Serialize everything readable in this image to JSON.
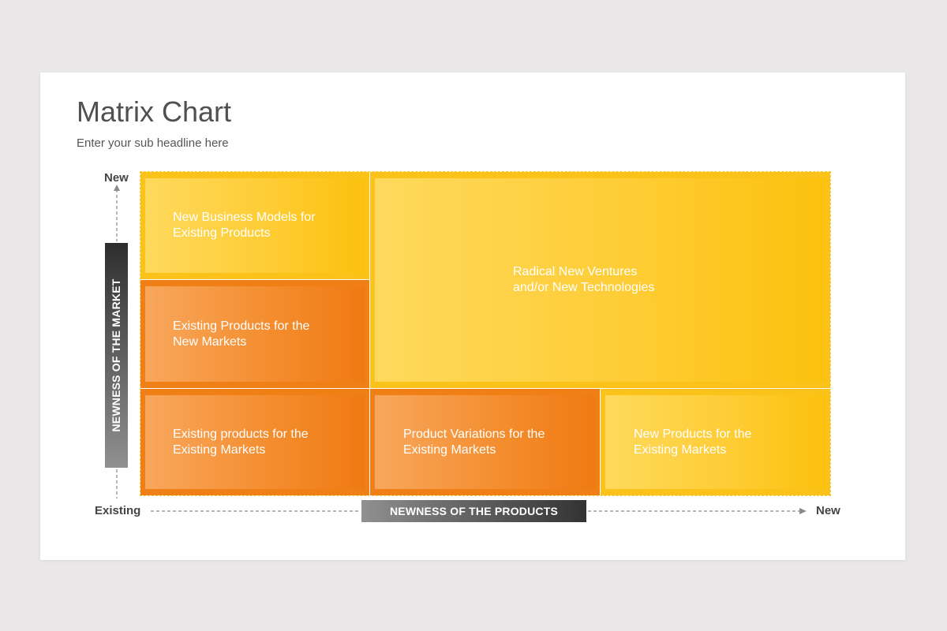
{
  "slide": {
    "title": "Matrix Chart",
    "subtitle": "Enter your sub headline here"
  },
  "axes": {
    "x": {
      "badge": "NEWNESS OF THE PRODUCTS",
      "start_label": "Existing",
      "end_label": "New"
    },
    "y": {
      "badge": "NEWNESS OF THE MARKET",
      "top_label": "New"
    }
  },
  "cells": {
    "new_business_models": {
      "line1": "New Business Models for",
      "line2": "Existing Products"
    },
    "existing_products_new_markets": {
      "line1": "Existing Products for the",
      "line2": "New Markets"
    },
    "existing_products_existing_markets": {
      "line1": "Existing products for the",
      "line2": "Existing Markets"
    },
    "radical_new_ventures": {
      "line1": "Radical New Ventures",
      "line2": "and/or New Technologies"
    },
    "product_variations": {
      "line1": "Product Variations for the",
      "line2": "Existing Markets"
    },
    "new_products": {
      "line1": "New Products for the",
      "line2": "Existing Markets"
    }
  },
  "colors": {
    "yellow": "#fbc31a",
    "orange": "#f07f16",
    "badge_dark": "#333333",
    "background": "#e9e7e8"
  }
}
